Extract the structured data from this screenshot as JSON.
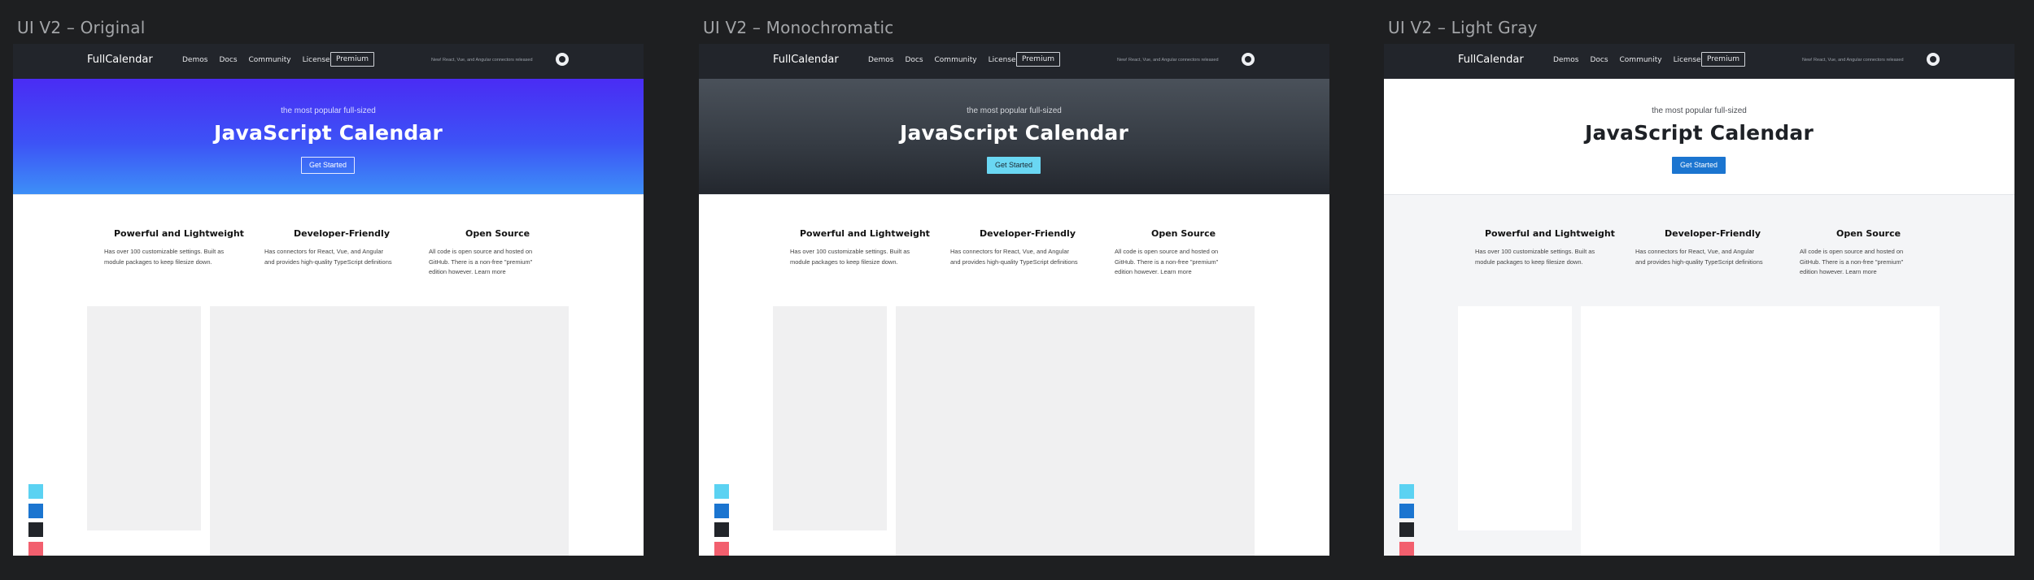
{
  "frames": [
    {
      "title": "UI V2 – Original"
    },
    {
      "title": "UI V2 – Monochromatic"
    },
    {
      "title": "UI V2 – Light Gray"
    }
  ],
  "site": {
    "brand": "FullCalendar",
    "nav": [
      "Demos",
      "Docs",
      "Community",
      "License"
    ],
    "premium": "Premium",
    "announcement": "New! React, Vue, and Angular connectors released",
    "github_icon": "github-icon",
    "hero_subtitle": "the most popular full-sized",
    "hero_title": "JavaScript Calendar",
    "cta": "Get Started",
    "features": [
      {
        "title": "Powerful and Lightweight",
        "text": "Has over 100 customizable settings. Built as module packages to keep filesize down."
      },
      {
        "title": "Developer-Friendly",
        "text": "Has connectors for React, Vue, and Angular and provides high-quality TypeScript definitions"
      },
      {
        "title": "Open Source",
        "text": "All code is open source and hosted on GitHub. There is a non-free \"premium\" edition however. Learn more"
      }
    ]
  },
  "palette": [
    "#5bd2f2",
    "#1b75d0",
    "#22252a",
    "#f25f6e",
    "#f5c865"
  ]
}
